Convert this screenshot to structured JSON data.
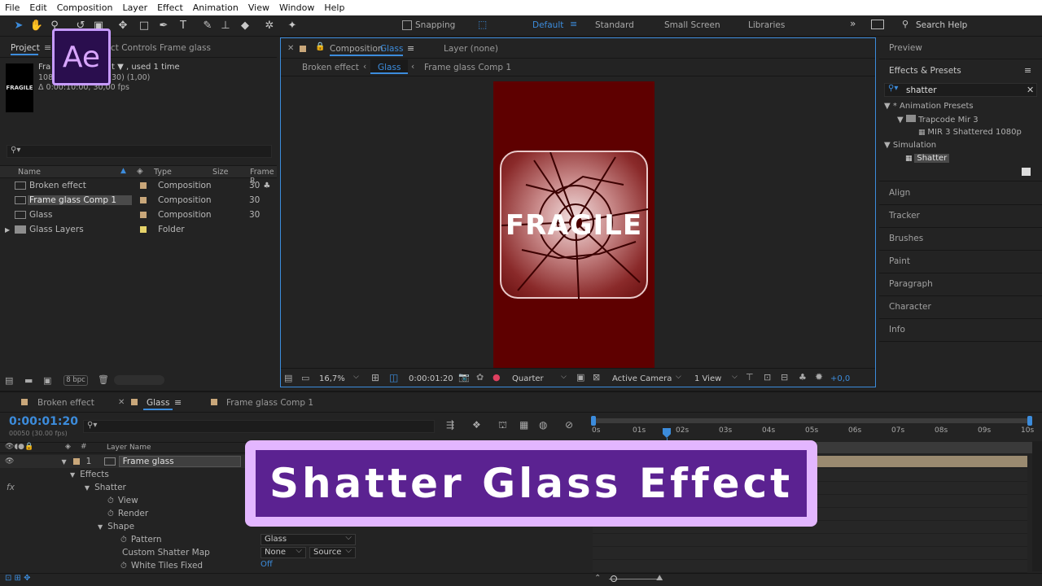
{
  "menu": [
    "File",
    "Edit",
    "Composition",
    "Layer",
    "Effect",
    "Animation",
    "View",
    "Window",
    "Help"
  ],
  "toolbar": {
    "snapping_label": "Snapping",
    "workspaces": [
      "Default",
      "Standard",
      "Small Screen",
      "Libraries"
    ],
    "search_help": "Search Help"
  },
  "app_logo": "Ae",
  "project_panel": {
    "tab_project": "Project",
    "tab_effect_controls": "ct Controls Frame glass",
    "item_name": "Fra",
    "item_meta1": "t ▼ , used 1 time",
    "item_meta2": "1080",
    "item_meta3": "30) (1,00)",
    "item_meta4": "Δ 0:00:10:00, 30,00 fps",
    "thumb_text": "FRAGILE",
    "columns": [
      "Name",
      "Type",
      "Size",
      "Frame R"
    ],
    "rows": [
      {
        "name": "Broken effect",
        "type": "Composition",
        "rate": "30"
      },
      {
        "name": "Frame glass Comp 1",
        "type": "Composition",
        "rate": "30"
      },
      {
        "name": "Glass",
        "type": "Composition",
        "rate": "30"
      },
      {
        "name": "Glass Layers",
        "type": "Folder",
        "rate": ""
      }
    ],
    "bpc": "8 bpc"
  },
  "comp_panel": {
    "tab_comp_prefix": "Composition",
    "tab_comp_name": "Glass",
    "tab_layer": "Layer (none)",
    "breadcrumbs": [
      "Broken effect",
      "Glass",
      "Frame glass Comp 1"
    ],
    "canvas_text": "FRAGILE",
    "zoom": "16,7%",
    "timecode": "0:00:01:20",
    "resolution": "Quarter",
    "camera": "Active Camera",
    "views": "1 View",
    "exposure": "+0,0"
  },
  "right_panel": {
    "preview": "Preview",
    "effects_presets": "Effects & Presets",
    "search_value": "shatter",
    "tree": {
      "animation_presets": "* Animation Presets",
      "trapcode": "Trapcode Mir 3",
      "mir_preset": "MIR 3 Shattered 1080p",
      "simulation": "Simulation",
      "shatter": "Shatter"
    },
    "panels": [
      "Align",
      "Tracker",
      "Brushes",
      "Paint",
      "Paragraph",
      "Character",
      "Info"
    ]
  },
  "timeline": {
    "tabs": [
      "Broken effect",
      "Glass",
      "Frame glass Comp 1"
    ],
    "timecode": "0:00:01:20",
    "fps_line": "00050 (30.00 fps)",
    "layer_name_col": "Layer Name",
    "layer_number": "1",
    "layer_name": "Frame glass",
    "effects": "Effects",
    "shatter": "Shatter",
    "view": "View",
    "render": "Render",
    "shape": "Shape",
    "pattern": "Pattern",
    "pattern_value": "Glass",
    "custom_map": "Custom Shatter Map",
    "custom_map_value": "None",
    "custom_map_source": "Source",
    "white_tiles": "White Tiles Fixed",
    "white_tiles_value": "Off",
    "ruler": [
      "0s",
      "01s",
      "02s",
      "03s",
      "04s",
      "05s",
      "06s",
      "07s",
      "08s",
      "09s",
      "10s"
    ]
  },
  "banner": {
    "title": "Shatter Glass Effect",
    "bg": "#5b2291",
    "border": "#e3b6ff"
  }
}
